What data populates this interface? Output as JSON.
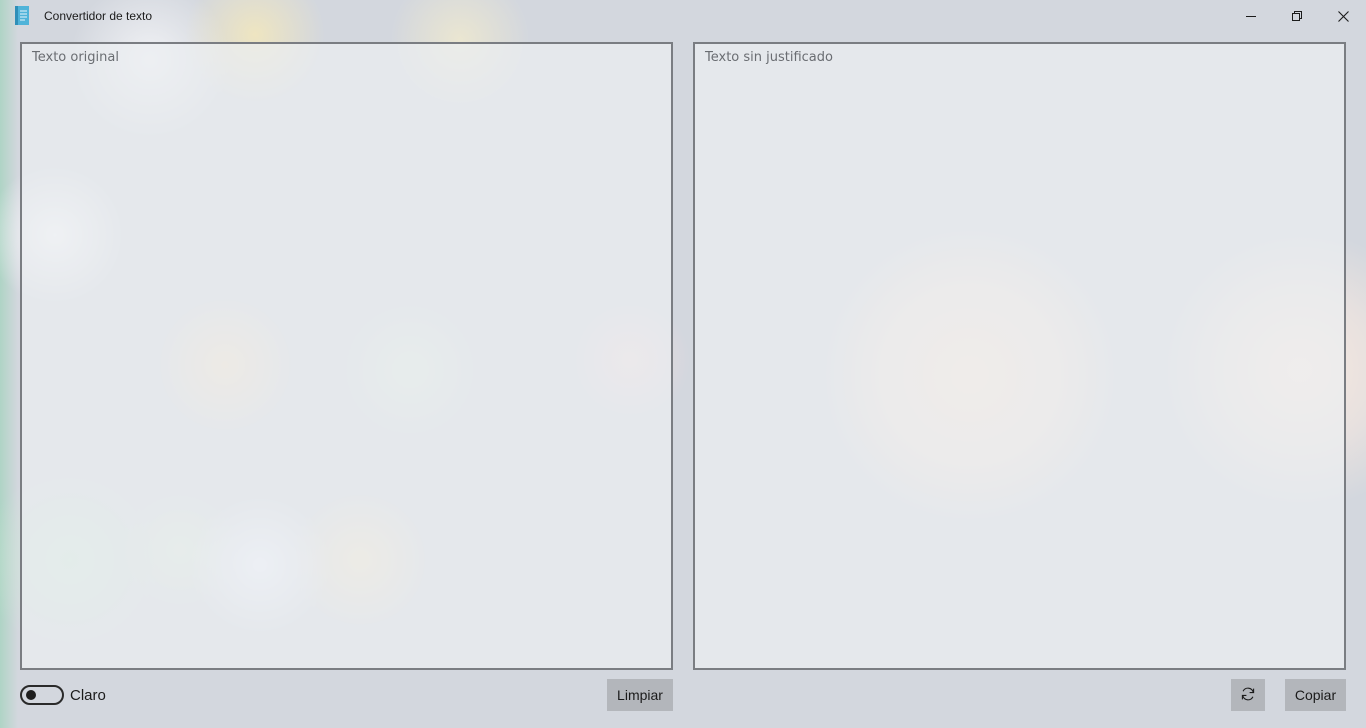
{
  "window": {
    "title": "Convertidor de texto",
    "icon": "document-icon",
    "controls": {
      "minimize": "minimize-icon",
      "maximize": "restore-icon",
      "close": "close-icon"
    }
  },
  "input_panel": {
    "placeholder": "Texto original",
    "value": ""
  },
  "output_panel": {
    "placeholder": "Texto sin justificado",
    "value": ""
  },
  "footer": {
    "theme_toggle_label": "Claro",
    "theme_toggle_on": false,
    "clear_button_label": "Limpiar",
    "refresh_button_icon": "refresh-icon",
    "copy_button_label": "Copiar"
  },
  "colors": {
    "panel_border": "#7a7d82",
    "button_bg": "#b3b6bb",
    "app_icon": "#4fb3d9"
  }
}
